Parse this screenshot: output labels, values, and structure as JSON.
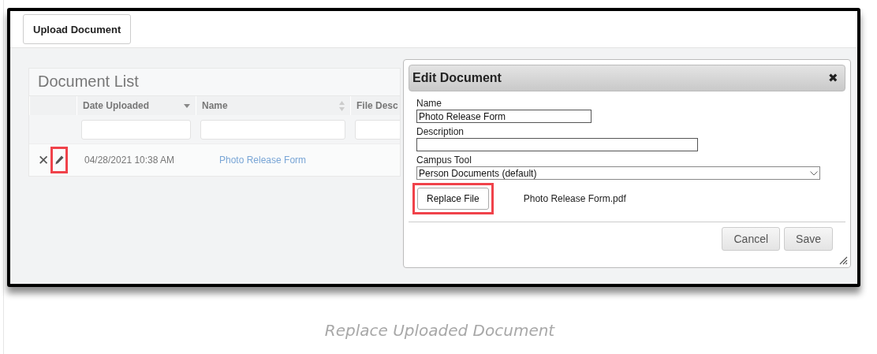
{
  "toolbar": {
    "upload_button": "Upload Document"
  },
  "document_list": {
    "title": "Document List",
    "columns": [
      {
        "label": "Date Uploaded",
        "kind": "sorted"
      },
      {
        "label": "Name",
        "kind": "sortable"
      },
      {
        "label": "File Desc"
      }
    ],
    "rows": [
      {
        "delete_icon": "✕",
        "edit_highlighted": true,
        "date": "04/28/2021 10:38 AM",
        "name": "Photo Release Form"
      }
    ]
  },
  "dialog": {
    "title": "Edit Document",
    "close": "✖",
    "fields": [
      {
        "kind": "text",
        "label": "Name",
        "value": "Photo Release Form"
      },
      {
        "kind": "textwide",
        "label": "Description"
      },
      {
        "kind": "select",
        "label": "Campus Tool",
        "value": "Person Documents (default)"
      }
    ],
    "replace_button": {
      "label": "Replace File",
      "highlighted": true
    },
    "file_name": "Photo Release Form.pdf",
    "buttons": [
      "Cancel",
      "Save"
    ]
  },
  "caption": "Replace Uploaded Document"
}
